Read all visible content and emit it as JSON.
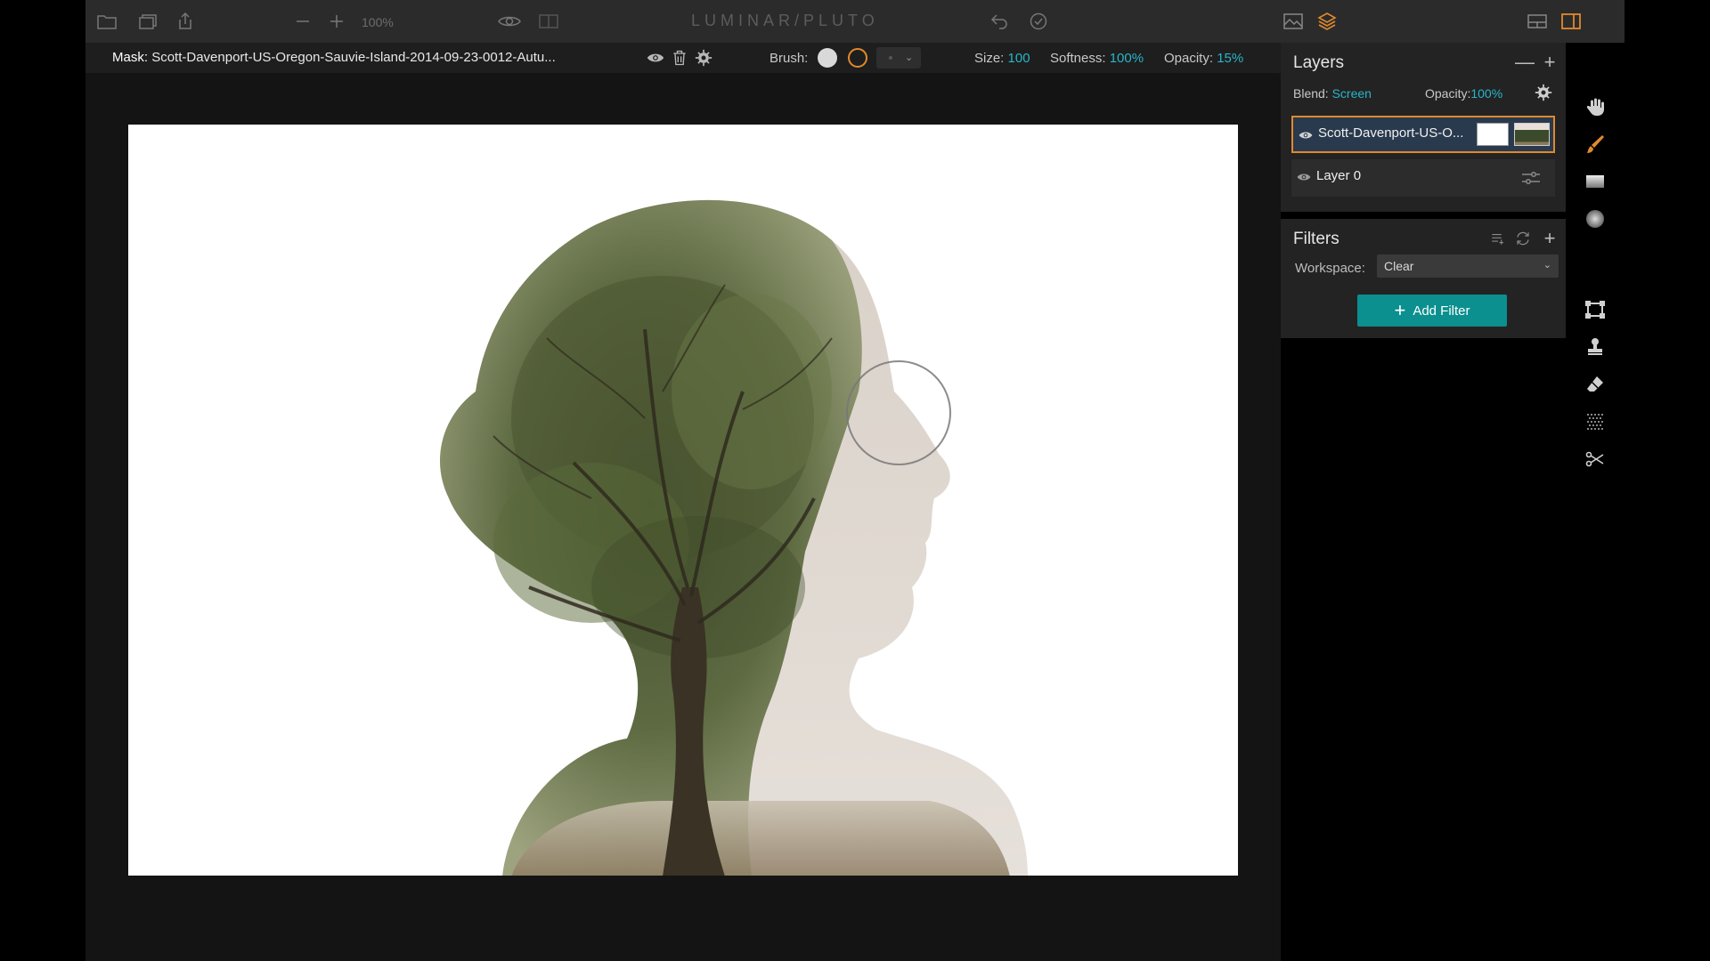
{
  "app": {
    "title": "LUMINAR/PLUTO"
  },
  "toolbar": {
    "zoom_level": "100%",
    "icons": [
      "open-folder-icon",
      "batch-icon",
      "share-icon",
      "zoom-out-icon",
      "zoom-in-icon",
      "eye-preview-icon",
      "compare-icon",
      "undo-icon",
      "history-icon",
      "image-browser-icon",
      "layers-icon",
      "single-view-icon",
      "side-panel-icon"
    ]
  },
  "mask_bar": {
    "label": "Mask:",
    "filename": "Scott-Davenport-US-Oregon-Sauvie-Island-2014-09-23-0012-Autu...",
    "brush_label": "Brush:",
    "size_label": "Size:",
    "size_value": "100",
    "softness_label": "Softness:",
    "softness_value": "100%",
    "opacity_label": "Opacity:",
    "opacity_value": "15%"
  },
  "layers": {
    "title": "Layers",
    "blend_label": "Blend:",
    "blend_value": "Screen",
    "opacity_label": "Opacity:",
    "opacity_value": "100%",
    "items": [
      {
        "name": "Scott-Davenport-US-O...",
        "selected": true
      },
      {
        "name": "Layer 0",
        "selected": false
      }
    ]
  },
  "filters": {
    "title": "Filters",
    "workspace_label": "Workspace:",
    "workspace_value": "Clear",
    "add_filter_label": "Add Filter"
  },
  "tools": [
    "hand-tool-icon",
    "brush-tool-icon",
    "gradient-tool-icon",
    "radial-tool-icon",
    "crop-tool-icon",
    "stamp-tool-icon",
    "eraser-tool-icon",
    "noise-tool-icon",
    "cut-tool-icon"
  ],
  "colors": {
    "accent": "#29b5c8",
    "selection": "#e0892c",
    "button": "#0b8f8f"
  }
}
